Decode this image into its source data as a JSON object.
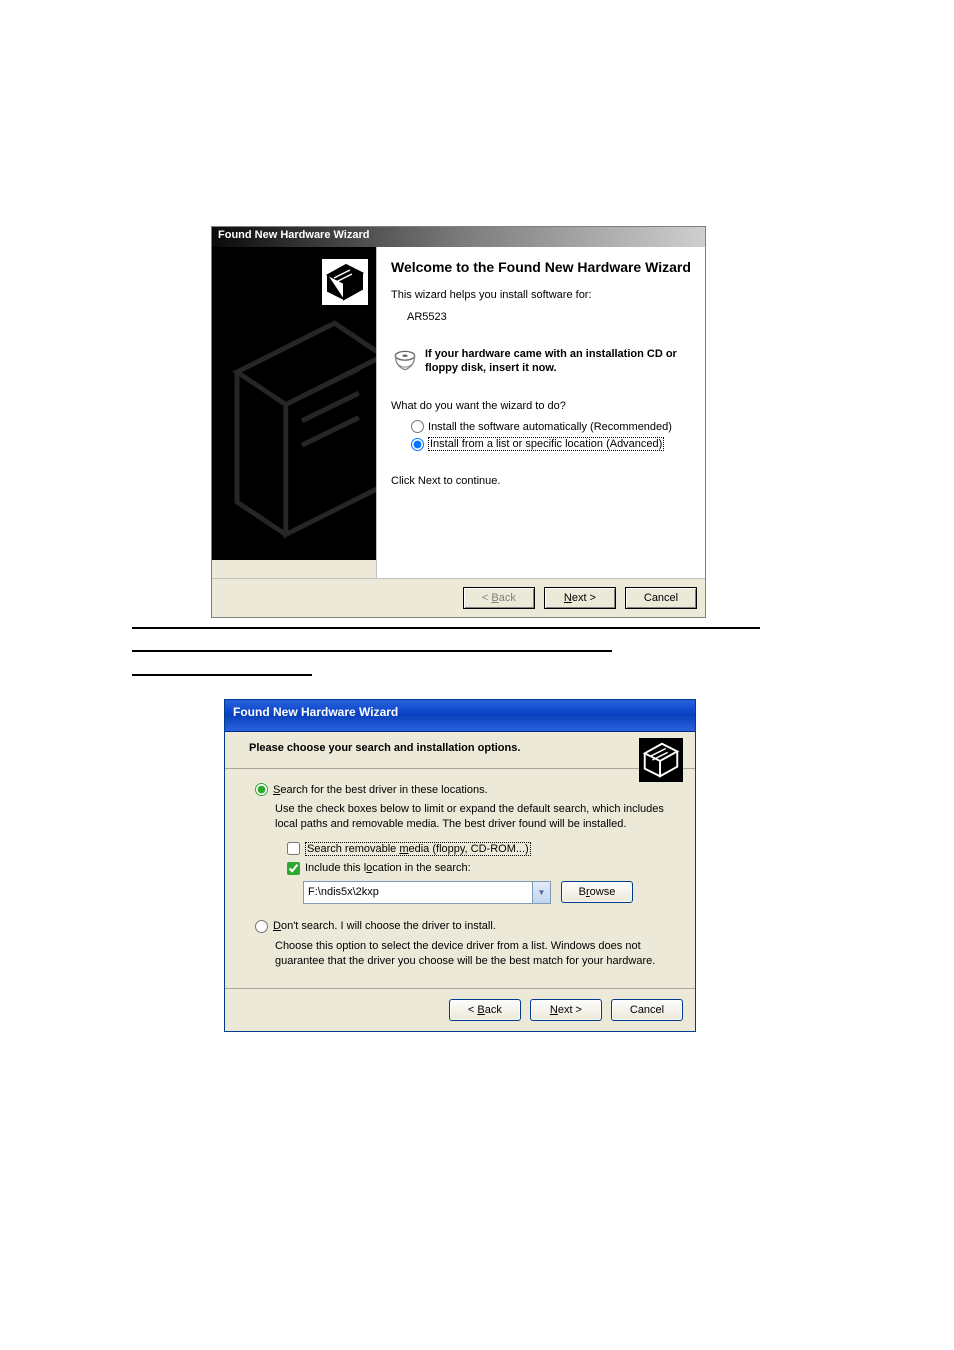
{
  "dialog1": {
    "title": "Found New Hardware Wizard",
    "heading": "Welcome to the Found New Hardware Wizard",
    "intro": "This wizard helps you install software for:",
    "device": "AR5523",
    "media_notice": "If your hardware came with an installation CD or floppy disk, insert it now.",
    "prompt": "What do you want the wizard to do?",
    "option_auto": "Install the software automatically (Recommended)",
    "option_list": "Install from a list or specific location (Advanced)",
    "click_next": "Click Next to continue.",
    "btn_back": "< Back",
    "btn_next": "Next >",
    "btn_cancel": "Cancel"
  },
  "dialog2": {
    "title": "Found New Hardware Wizard",
    "header": "Please choose your search and installation options.",
    "opt_search": "Search for the best driver in these locations.",
    "search_help": "Use the check boxes below to limit or expand the default search, which includes local paths and removable media. The best driver found will be installed.",
    "chk_removable": "Search removable media (floppy, CD-ROM...)",
    "chk_include": "Include this location in the search:",
    "path": "F:\\ndis5x\\2kxp",
    "btn_browse": "Browse",
    "opt_dont": "Don't search. I will choose the driver to install.",
    "dont_help": "Choose this option to select the device driver from a list.  Windows does not guarantee that the driver you choose will be the best match for your hardware.",
    "btn_back": "< Back",
    "btn_next": "Next >",
    "btn_cancel": "Cancel"
  }
}
